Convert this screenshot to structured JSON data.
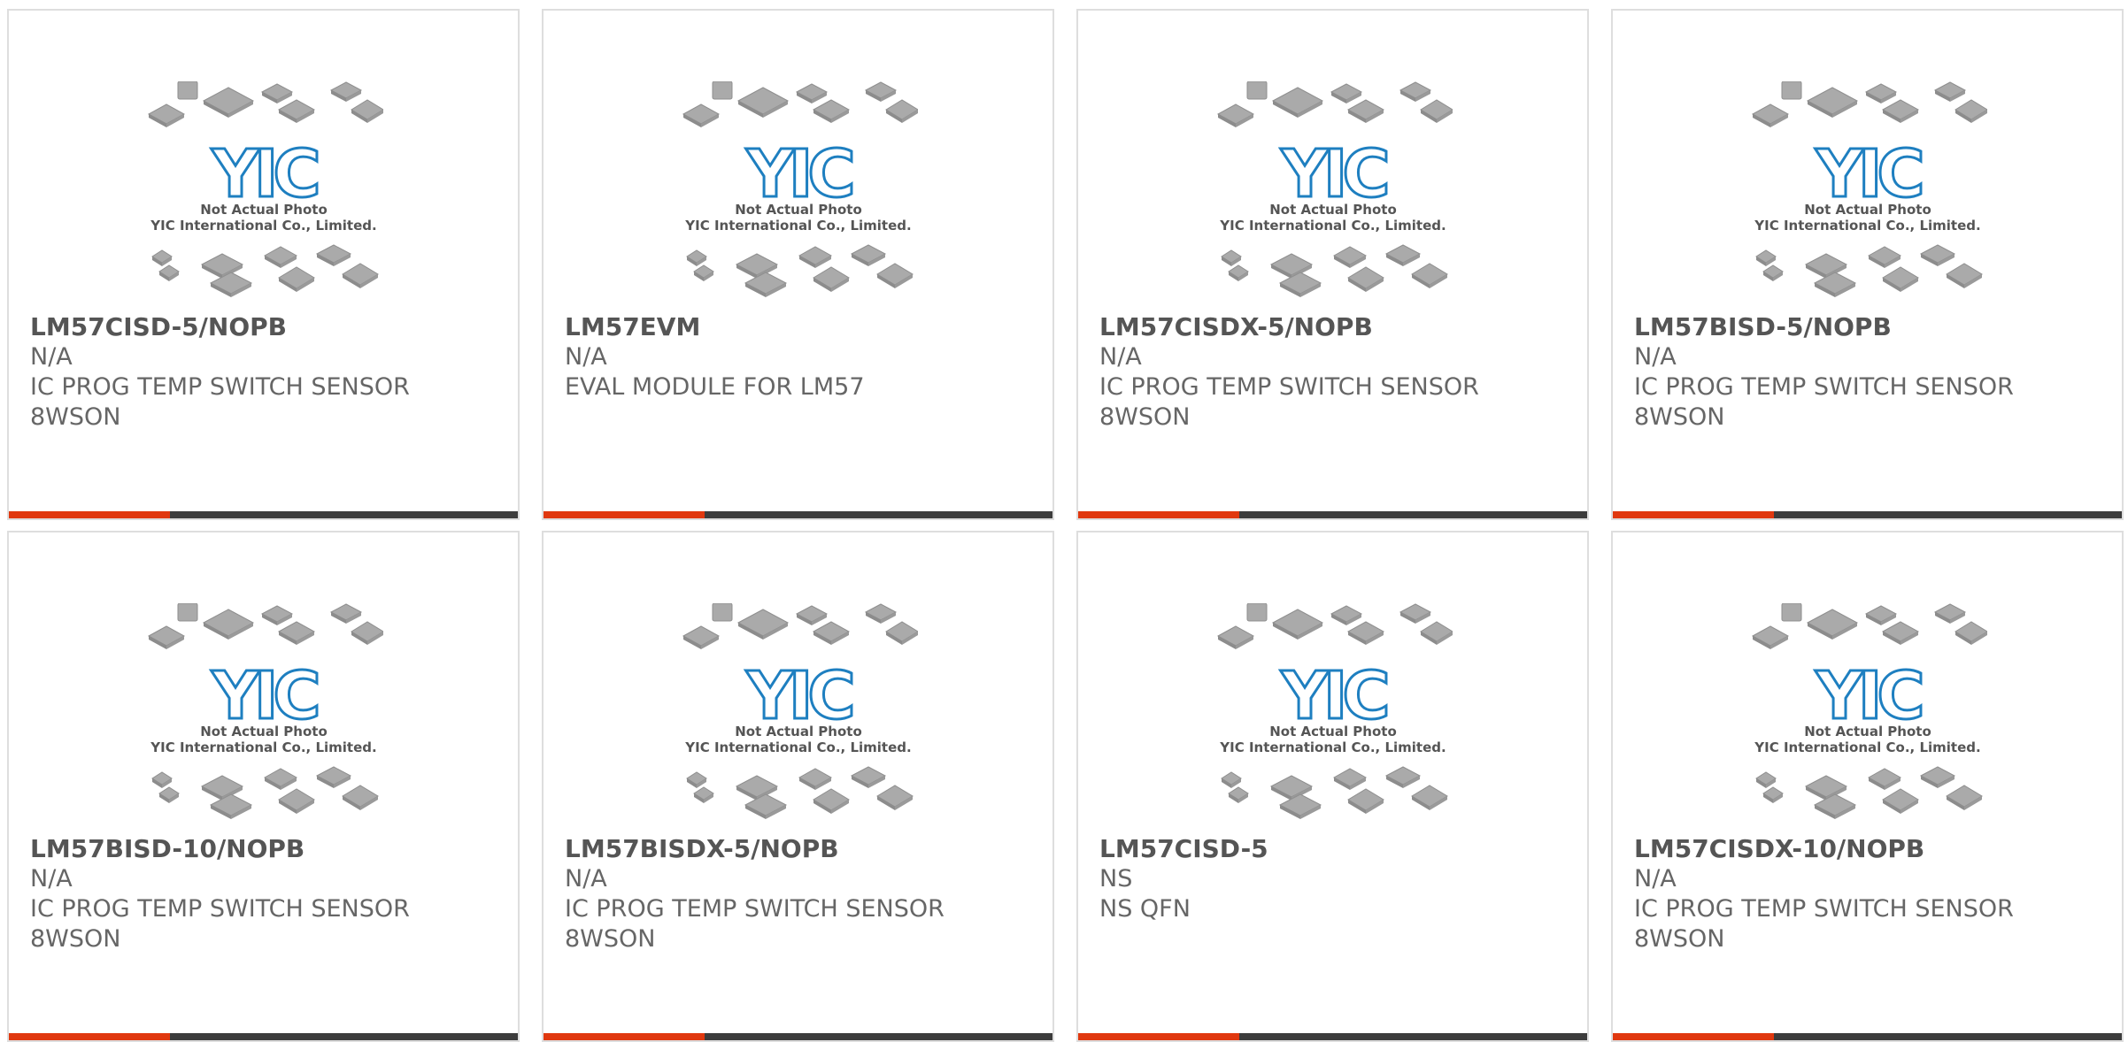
{
  "placeholder": {
    "brand": "YIC",
    "caption_line1": "Not Actual Photo",
    "caption_line2": "YIC International Co., Limited."
  },
  "colors": {
    "accent": "#e0380f",
    "bar": "#3c3c3c",
    "border": "#dedede",
    "logo": "#1e7fc0",
    "chip": "#aaaaaa"
  },
  "products": [
    {
      "part": "LM57CISD-5/NOPB",
      "manufacturer": "N/A",
      "desc1": "IC PROG TEMP SWITCH SENSOR",
      "desc2": "8WSON"
    },
    {
      "part": "LM57EVM",
      "manufacturer": "N/A",
      "desc1": "EVAL MODULE FOR LM57",
      "desc2": ""
    },
    {
      "part": "LM57CISDX-5/NOPB",
      "manufacturer": "N/A",
      "desc1": "IC PROG TEMP SWITCH SENSOR",
      "desc2": "8WSON"
    },
    {
      "part": "LM57BISD-5/NOPB",
      "manufacturer": "N/A",
      "desc1": "IC PROG TEMP SWITCH SENSOR",
      "desc2": "8WSON"
    },
    {
      "part": "LM57BISD-10/NOPB",
      "manufacturer": "N/A",
      "desc1": "IC PROG TEMP SWITCH SENSOR",
      "desc2": "8WSON"
    },
    {
      "part": "LM57BISDX-5/NOPB",
      "manufacturer": "N/A",
      "desc1": "IC PROG TEMP SWITCH SENSOR",
      "desc2": "8WSON"
    },
    {
      "part": "LM57CISD-5",
      "manufacturer": "NS",
      "desc1": "NS QFN",
      "desc2": ""
    },
    {
      "part": "LM57CISDX-10/NOPB",
      "manufacturer": "N/A",
      "desc1": "IC PROG TEMP SWITCH SENSOR",
      "desc2": "8WSON"
    }
  ]
}
